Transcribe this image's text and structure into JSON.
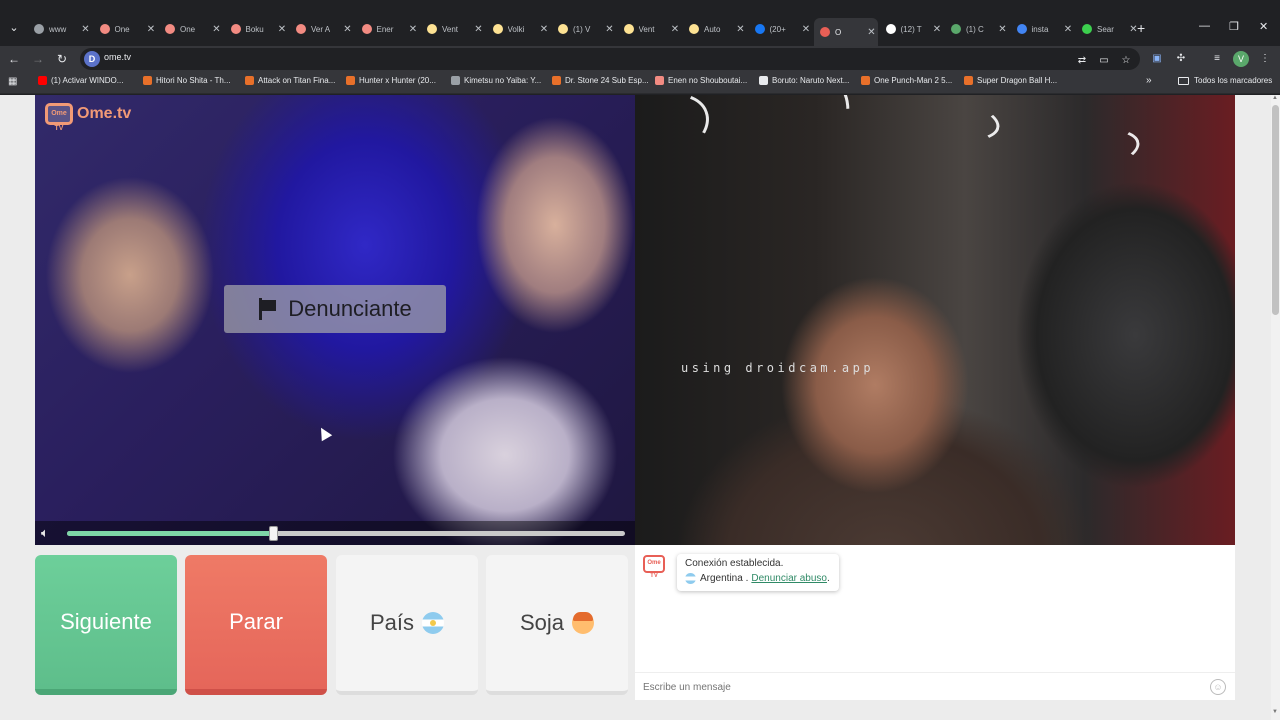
{
  "tabs": [
    {
      "label": "www",
      "favicon_color": "#9aa0a6"
    },
    {
      "label": "One",
      "favicon_color": "#f28b82"
    },
    {
      "label": "One",
      "favicon_color": "#f28b82"
    },
    {
      "label": "Boku",
      "favicon_color": "#f28b82"
    },
    {
      "label": "Ver A",
      "favicon_color": "#f28b82"
    },
    {
      "label": "Ener",
      "favicon_color": "#f28b82"
    },
    {
      "label": "Vent",
      "favicon_color": "#fde293"
    },
    {
      "label": "Volki",
      "favicon_color": "#fde293"
    },
    {
      "label": "(1) V",
      "favicon_color": "#fde293"
    },
    {
      "label": "Vent",
      "favicon_color": "#fde293"
    },
    {
      "label": "Auto",
      "favicon_color": "#fde293"
    },
    {
      "label": "(20+",
      "favicon_color": "#1877f2"
    },
    {
      "label": "O",
      "favicon_color": "#e85f56",
      "active": true
    },
    {
      "label": "(12) T",
      "favicon_color": "#ffffff"
    },
    {
      "label": "(1) C",
      "favicon_color": "#5aa86b"
    },
    {
      "label": "insta",
      "favicon_color": "#4285f4"
    },
    {
      "label": "Sear",
      "favicon_color": "#3ccf4e"
    }
  ],
  "address_bar": {
    "url": "ome.tv",
    "site_letter": "D"
  },
  "profile_letter": "V",
  "bookmarks": [
    {
      "label": "(1) Activar WINDO...",
      "color": "#ff0000"
    },
    {
      "label": "Hitori No Shita - Th...",
      "color": "#e8702a"
    },
    {
      "label": "Attack on Titan Fina...",
      "color": "#e8702a"
    },
    {
      "label": "Hunter x Hunter (20...",
      "color": "#e8702a"
    },
    {
      "label": "Kimetsu no Yaiba: Y...",
      "color": "#9aa0a6"
    },
    {
      "label": "Dr. Stone 24 Sub Esp...",
      "color": "#e8702a"
    },
    {
      "label": "Enen no Shouboutai...",
      "color": "#f28b82"
    },
    {
      "label": "Boruto: Naruto Next...",
      "color": "#e8eaed"
    },
    {
      "label": "One Punch-Man 2 5...",
      "color": "#e8702a"
    },
    {
      "label": "Super Dragon Ball H...",
      "color": "#e8702a"
    }
  ],
  "bookmarks_all": "Todos los marcadores",
  "left_video": {
    "logo_small": "Ome TV",
    "logo_text": "Ome.tv",
    "report_label": "Denunciante",
    "volume_fraction": 0.37
  },
  "right_video": {
    "watermark": "using droidcam.app"
  },
  "controls": {
    "next": "Siguiente",
    "stop": "Parar",
    "country": "País",
    "gender": "Soja"
  },
  "chat": {
    "logo_small": "Ome TV",
    "message_line1": "Conexión establecida.",
    "country": "Argentina .",
    "report_link": "Denunciar abuso",
    "link_suffix": ".",
    "input_placeholder": "Escribe un mensaje"
  }
}
